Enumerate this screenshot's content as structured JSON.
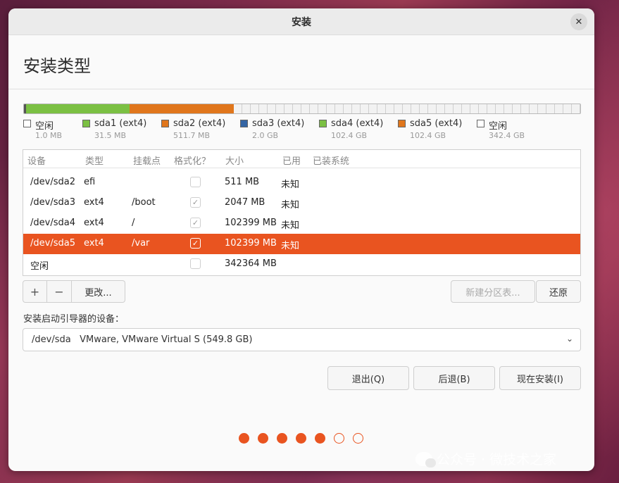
{
  "window": {
    "title": "安装",
    "close_glyph": "✕"
  },
  "page_title": "安装类型",
  "partition_legend": [
    {
      "name": "空闲",
      "size": "1.0 MB",
      "color": "#ffffff"
    },
    {
      "name": "sda1 (ext4)",
      "size": "31.5 MB",
      "color": "#7bc043"
    },
    {
      "name": "sda2 (ext4)",
      "size": "511.7 MB",
      "color": "#e0761c"
    },
    {
      "name": "sda3 (ext4)",
      "size": "2.0 GB",
      "color": "#3465a4"
    },
    {
      "name": "sda4 (ext4)",
      "size": "102.4 GB",
      "color": "#7bc043"
    },
    {
      "name": "sda5 (ext4)",
      "size": "102.4 GB",
      "color": "#e0761c"
    },
    {
      "name": "空闲",
      "size": "342.4 GB",
      "color": "#ffffff"
    }
  ],
  "table": {
    "headers": [
      "设备",
      "类型",
      "挂载点",
      "格式化？",
      "大小",
      "已用",
      "已装系统"
    ],
    "rows": [
      {
        "device": "/dev/sda2",
        "type": "efi",
        "mount": "",
        "format": false,
        "size": "511 MB",
        "used": "未知",
        "system": "",
        "selected": false
      },
      {
        "device": "/dev/sda3",
        "type": "ext4",
        "mount": "/boot",
        "format": true,
        "size": "2047 MB",
        "used": "未知",
        "system": "",
        "selected": false
      },
      {
        "device": "/dev/sda4",
        "type": "ext4",
        "mount": "/",
        "format": true,
        "size": "102399 MB",
        "used": "未知",
        "system": "",
        "selected": false
      },
      {
        "device": "/dev/sda5",
        "type": "ext4",
        "mount": "/var",
        "format": true,
        "size": "102399 MB",
        "used": "未知",
        "system": "",
        "selected": true
      },
      {
        "device": "空闲",
        "type": "",
        "mount": "",
        "format": false,
        "size": "342364 MB",
        "used": "",
        "system": "",
        "selected": false
      }
    ]
  },
  "toolbar": {
    "add_glyph": "+",
    "remove_glyph": "−",
    "change_label": "更改...",
    "new_table_label": "新建分区表...",
    "revert_label": "还原"
  },
  "bootloader": {
    "label": "安装启动引导器的设备：",
    "value": "/dev/sda   VMware, VMware Virtual S (549.8 GB)"
  },
  "actions": {
    "quit_label": "退出(Q)",
    "back_label": "后退(B)",
    "install_label": "现在安装(I)"
  },
  "progress": {
    "total_steps": 7,
    "current_step": 5
  },
  "watermark": {
    "text": "公众号 · 微技术之家"
  },
  "colors": {
    "accent": "#e95420"
  }
}
